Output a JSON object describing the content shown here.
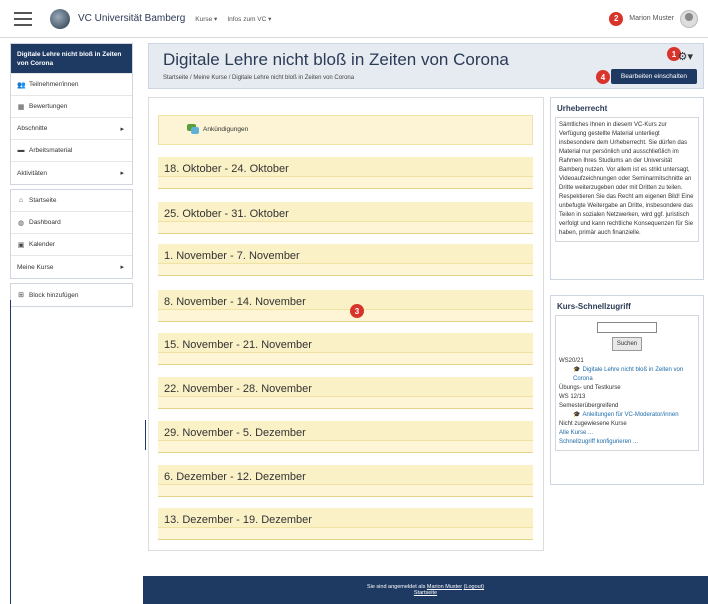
{
  "navbar": {
    "brand": "VC Universität Bamberg",
    "menu": [
      "Kurse ▾",
      "Infos zum VC ▾"
    ],
    "user_name": "Marion Muster",
    "badge": "2"
  },
  "sidebar": {
    "active": "Digitale Lehre nicht bloß in Zeiten von Corona",
    "group1": [
      {
        "label": "Teilnehmer/innen",
        "icon": "users-icon",
        "glyph": "👥",
        "chev": ""
      },
      {
        "label": "Bewertungen",
        "icon": "table-icon",
        "glyph": "▦",
        "chev": ""
      },
      {
        "label": "Abschnitte",
        "icon": "",
        "glyph": "",
        "chev": "▸"
      },
      {
        "label": "Arbeitsmaterial",
        "icon": "archive-icon",
        "glyph": "▬",
        "chev": ""
      },
      {
        "label": "Aktivitäten",
        "icon": "",
        "glyph": "",
        "chev": "▸"
      }
    ],
    "group2": [
      {
        "label": "Startseite",
        "icon": "home-icon",
        "glyph": "⌂",
        "chev": ""
      },
      {
        "label": "Dashboard",
        "icon": "dashboard-icon",
        "glyph": "◍",
        "chev": ""
      },
      {
        "label": "Kalender",
        "icon": "calendar-icon",
        "glyph": "▣",
        "chev": ""
      },
      {
        "label": "Meine Kurse",
        "icon": "",
        "glyph": "",
        "chev": "▸"
      }
    ],
    "add_block": "Block hinzufügen"
  },
  "header": {
    "title": "Digitale Lehre nicht bloß in Zeiten von Corona",
    "breadcrumb": "Startseite / Meine Kurse / Digitale Lehre nicht bloß in Zeiten von Corona",
    "edit_button": "Bearbeiten einschalten",
    "badge_gear": "1",
    "badge_edit": "4"
  },
  "announcements": "Ankündigungen",
  "sections": [
    "18. Oktober - 24. Oktober",
    "25. Oktober - 31. Oktober",
    "1. November - 7. November",
    "8. November - 14. November",
    "15. November - 21. November",
    "22. November - 28. November",
    "29. November - 5. Dezember",
    "6. Dezember - 12. Dezember",
    "13. Dezember - 19. Dezember"
  ],
  "section_badge": "3",
  "copyright": {
    "title": "Urheberrecht",
    "text": "Sämtliches Ihnen in diesem VC-Kurs zur Verfügung gestellte Material unterliegt insbesondere dem Urheberrecht. Sie dürfen das Material nur persönlich und ausschließlich im Rahmen Ihres Studiums an der Universität Bamberg nutzen. Vor allem ist es strikt untersagt, Videoaufzeichnungen oder Seminarmitschnitte an Dritte weiterzugeben oder mit Dritten zu teilen. Respektieren Sie das Recht am eigenen Bild! Eine unbefugte Weitergabe an Dritte, insbesondere das Teilen in sozialen Netzwerken, wird ggf. juristisch verfolgt und kann rechtliche Konsequenzen für Sie haben, primär auch finanzielle."
  },
  "quick": {
    "title": "Kurs-Schnellzugriff",
    "search_button": "Suchen",
    "ws2021": "WS20/21",
    "course1": "Digitale Lehre nicht bloß in Zeiten von Corona",
    "test": "Übungs- und Testkurse",
    "ws1213": "WS 12/13",
    "sem": "Semesterübergreifend",
    "course2": "Anleitungen für VC-Moderator/innen",
    "unassigned": "Nicht zugewiesene Kurse",
    "all": "Alle Kurse ...",
    "config": "Schnellzugriff konfigurieren ..."
  },
  "footer": {
    "logged_in_prefix": "Sie sind angemeldet als ",
    "user": "Marion Muster",
    "logout": "(Logout)",
    "home": "Startseite"
  }
}
